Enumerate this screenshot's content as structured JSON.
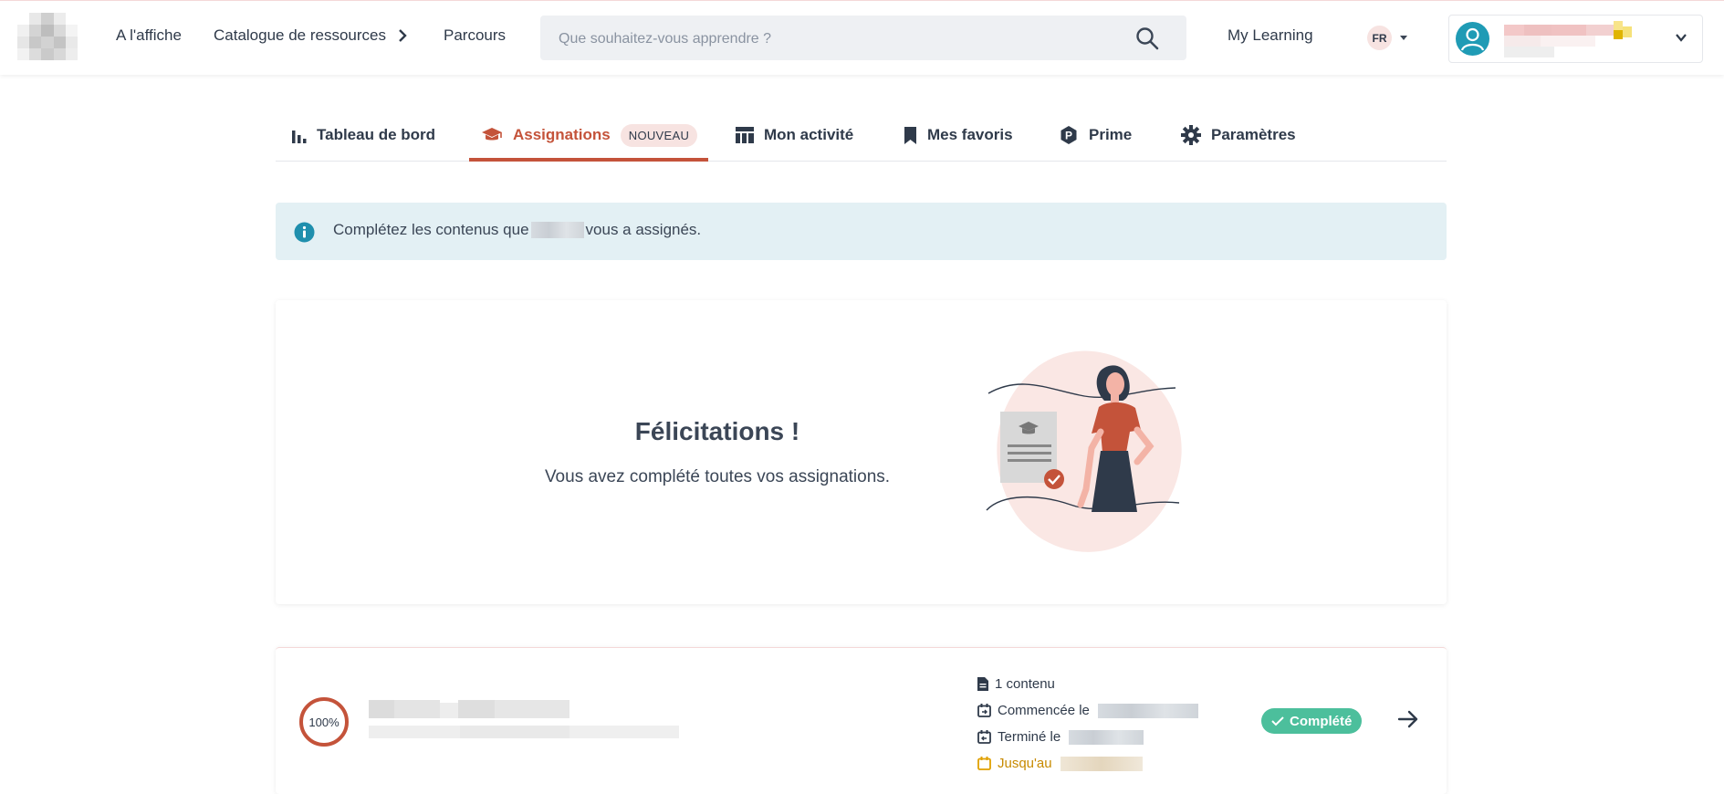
{
  "header": {
    "logo_name": "company-logo",
    "nav": [
      {
        "label": "A l'affiche"
      },
      {
        "label": "Catalogue de ressources"
      },
      {
        "label": "Parcours"
      }
    ],
    "search": {
      "placeholder": "Que souhaitez-vous apprendre ?",
      "value": ""
    },
    "my_learning": "My Learning",
    "language": "FR"
  },
  "tabs": [
    {
      "label": "Tableau de bord",
      "icon": "bar-chart-icon"
    },
    {
      "label": "Assignations",
      "icon": "graduation-cap-icon",
      "badge": "NOUVEAU",
      "active": true
    },
    {
      "label": "Mon activité",
      "icon": "table-icon"
    },
    {
      "label": "Mes favoris",
      "icon": "bookmark-icon"
    },
    {
      "label": "Prime",
      "icon": "prime-icon"
    },
    {
      "label": "Paramètres",
      "icon": "gear-icon"
    }
  ],
  "info_banner": {
    "text_before": "Complétez les contenus que",
    "text_after": "vous a assignés."
  },
  "congrats": {
    "title": "Félicitations !",
    "subtitle": "Vous avez complété toutes vos assignations."
  },
  "assignment": {
    "progress": "100%",
    "progress_fraction": 1.0,
    "contents": "1 contenu",
    "started_label": "Commencée le",
    "finished_label": "Terminé le",
    "due_label": "Jusqu'au",
    "status": "Complété"
  },
  "colors": {
    "accent": "#c4533a",
    "info_bg": "#e3f0f4",
    "success": "#4cbf9c",
    "warning": "#e0a000"
  }
}
